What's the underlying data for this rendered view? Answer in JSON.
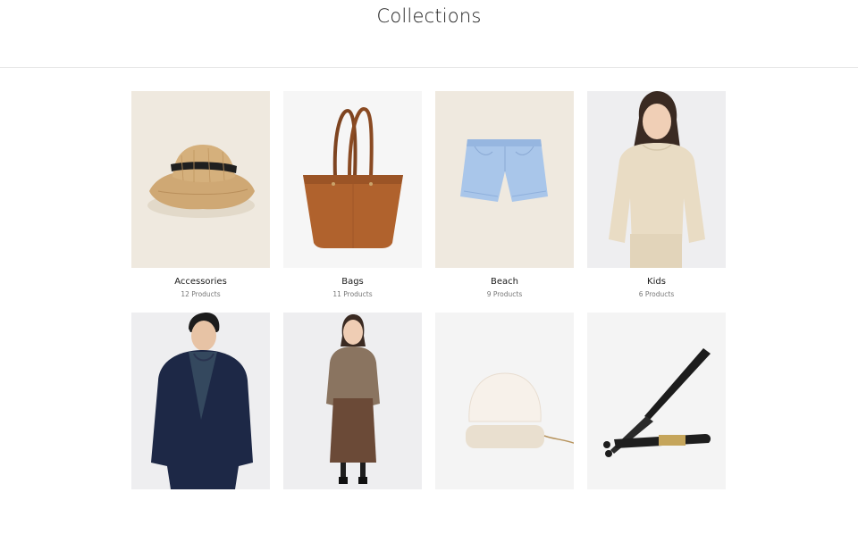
{
  "page": {
    "title": "Collections"
  },
  "collections": [
    {
      "title": "Accessories",
      "count": "12 Products",
      "icon": "straw-hat-image",
      "bg": "#efe9df"
    },
    {
      "title": "Bags",
      "count": "11 Products",
      "icon": "leather-tote-bag-image",
      "bg": "#f6f6f6"
    },
    {
      "title": "Beach",
      "count": "9 Products",
      "icon": "blue-shorts-image",
      "bg": "#efe9df"
    },
    {
      "title": "Kids",
      "count": "6 Products",
      "icon": "girl-sweatshirt-image",
      "bg": "#eeeef0"
    },
    {
      "title": "",
      "count": "",
      "icon": "man-fleece-jacket-image",
      "bg": "#eeeef0"
    },
    {
      "title": "",
      "count": "",
      "icon": "woman-cardigan-skirt-image",
      "bg": "#eeeef0"
    },
    {
      "title": "",
      "count": "",
      "icon": "table-lamp-image",
      "bg": "#f4f4f4"
    },
    {
      "title": "",
      "count": "",
      "icon": "baseball-bat-image",
      "bg": "#f4f4f4"
    }
  ]
}
